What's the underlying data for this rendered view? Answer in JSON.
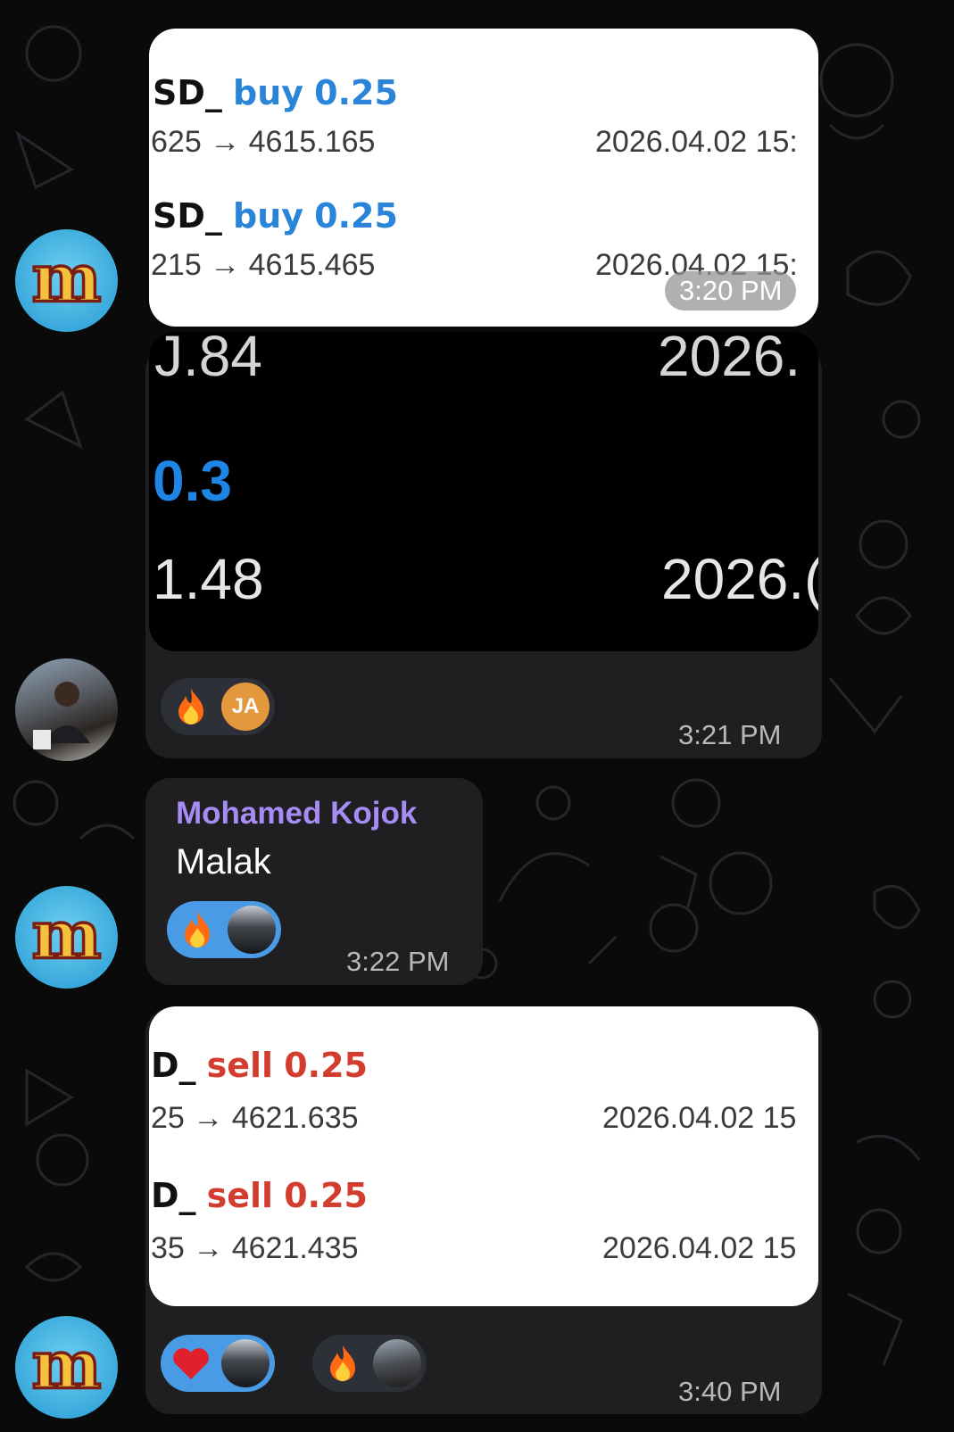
{
  "messages": [
    {
      "trades": [
        {
          "prefix": "SD_",
          "side": "buy",
          "amount": "0.25",
          "route": "625 → 4615.165",
          "date": "2026.04.02 15:"
        },
        {
          "prefix": "SD_",
          "side": "buy",
          "amount": "0.25",
          "route": "215 → 4615.465",
          "date": "2026.04.02 15:"
        }
      ],
      "time": "3:20 PM"
    },
    {
      "top_left": "J.84",
      "top_right": "2026.",
      "highlight": "0.3",
      "value": "1.48",
      "date": "2026.(",
      "reactions": [
        {
          "emoji": "fire",
          "avatar": "JA"
        }
      ],
      "time": "3:21 PM"
    },
    {
      "sender": "Mohamed Kojok",
      "text": "Malak",
      "reactions": [
        {
          "emoji": "fire"
        }
      ],
      "time": "3:22 PM"
    },
    {
      "trades": [
        {
          "prefix": "D_",
          "side": "sell",
          "amount": "0.25",
          "route": "25 → 4621.635",
          "date": "2026.04.02 15"
        },
        {
          "prefix": "D_",
          "side": "sell",
          "amount": "0.25",
          "route": "35 → 4621.435",
          "date": "2026.04.02 15"
        }
      ],
      "reactions": [
        {
          "emoji": "heart"
        },
        {
          "emoji": "fire"
        }
      ],
      "time": "3:40 PM"
    }
  ],
  "colors": {
    "buy": "#2a84d8",
    "sell": "#d23d2f",
    "sender": "#a68cf5",
    "bubble": "#1f1f22"
  }
}
